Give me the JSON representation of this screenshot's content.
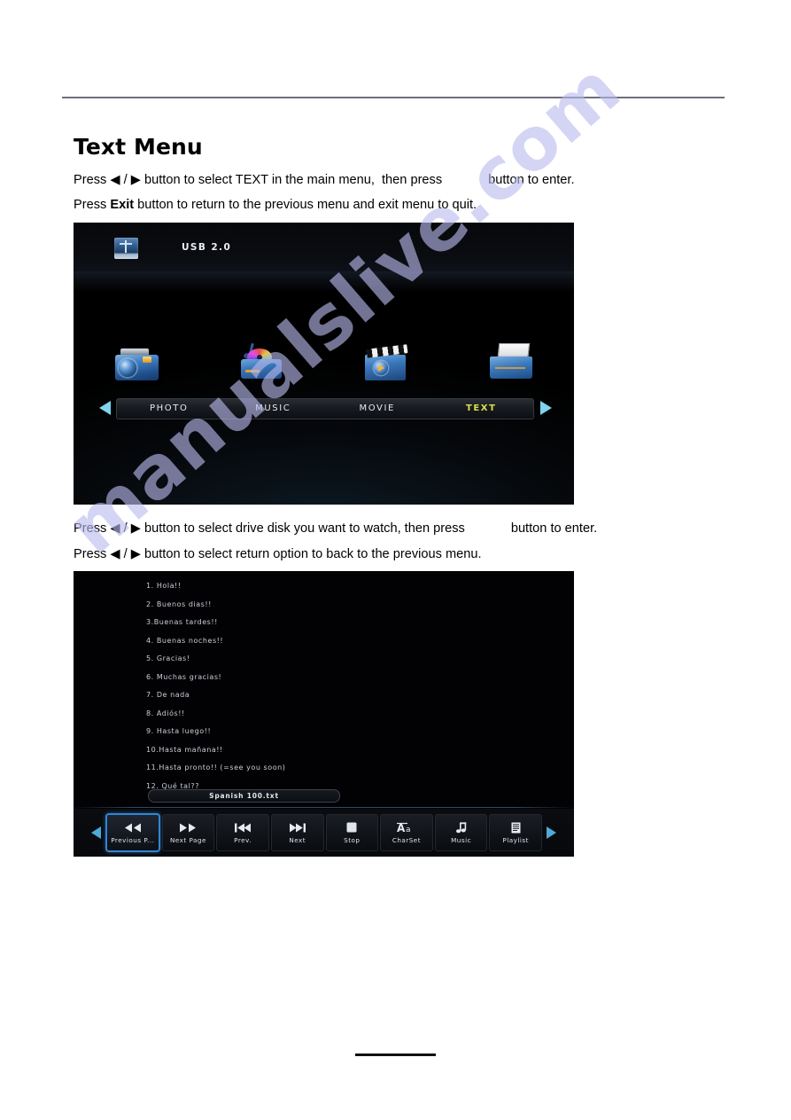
{
  "document": {
    "title": "Text Menu",
    "intro_lines": [
      {
        "prefix": "Press ◀ / ▶ button to select TEXT in the main menu,  then press",
        "suffix": "button to enter."
      },
      {
        "prefix": "Press ",
        "bold": "Exit",
        "suffix": " button to return to the previous menu and exit menu to quit."
      }
    ],
    "mid_lines": [
      {
        "prefix": "Press ◀ / ▶ button to select drive disk you want to watch, then press",
        "suffix": "button to enter."
      },
      {
        "text": "Press ◀ / ▶ button to select return option to back to the previous menu."
      }
    ],
    "watermark": "manualslive.com"
  },
  "main_menu_screen": {
    "device_label": "USB 2.0",
    "device_icon": "usb-drive-icon",
    "left_arrow_icon": "arrow-left-icon",
    "right_arrow_icon": "arrow-right-icon",
    "items": [
      {
        "label": "PHOTO",
        "icon": "camera-icon",
        "selected": false
      },
      {
        "label": "MUSIC",
        "icon": "music-disc-icon",
        "selected": false
      },
      {
        "label": "MOVIE",
        "icon": "clapperboard-icon",
        "selected": false
      },
      {
        "label": "TEXT",
        "icon": "document-folder-icon",
        "selected": true
      }
    ],
    "selected_color": "#d8e04a",
    "selection_border_color": "#4fa8c8",
    "arrow_color": "#7fd4ee"
  },
  "text_viewer_screen": {
    "lines": [
      "1. Hola!!",
      "2. Buenos dias!!",
      "3.Buenas tardes!!",
      "4. Buenas noches!!",
      "5. Gracias!",
      "6. Muchas gracias!",
      "7. De nada",
      "8. Adiós!!",
      "9. Hasta luego!!",
      "10.Hasta mañana!!",
      "11.Hasta pronto!! (=see you soon)",
      "12. Qué tal??"
    ],
    "filename": "Spanish 100.txt",
    "left_arrow_icon": "arrow-left-icon",
    "right_arrow_icon": "arrow-right-icon",
    "arrow_color": "#4fa9d8",
    "selection_border_color": "#2f86d4",
    "toolbar": [
      {
        "label": "Previous P...",
        "icon": "rewind-icon",
        "selected": true
      },
      {
        "label": "Next Page",
        "icon": "fast-forward-icon",
        "selected": false
      },
      {
        "label": "Prev.",
        "icon": "skip-previous-icon",
        "selected": false
      },
      {
        "label": "Next",
        "icon": "skip-next-icon",
        "selected": false
      },
      {
        "label": "Stop",
        "icon": "stop-icon",
        "selected": false
      },
      {
        "label": "CharSet",
        "icon": "font-aa-icon",
        "selected": false
      },
      {
        "label": "Music",
        "icon": "music-note-icon",
        "selected": false
      },
      {
        "label": "Playlist",
        "icon": "playlist-icon",
        "selected": false
      }
    ]
  }
}
